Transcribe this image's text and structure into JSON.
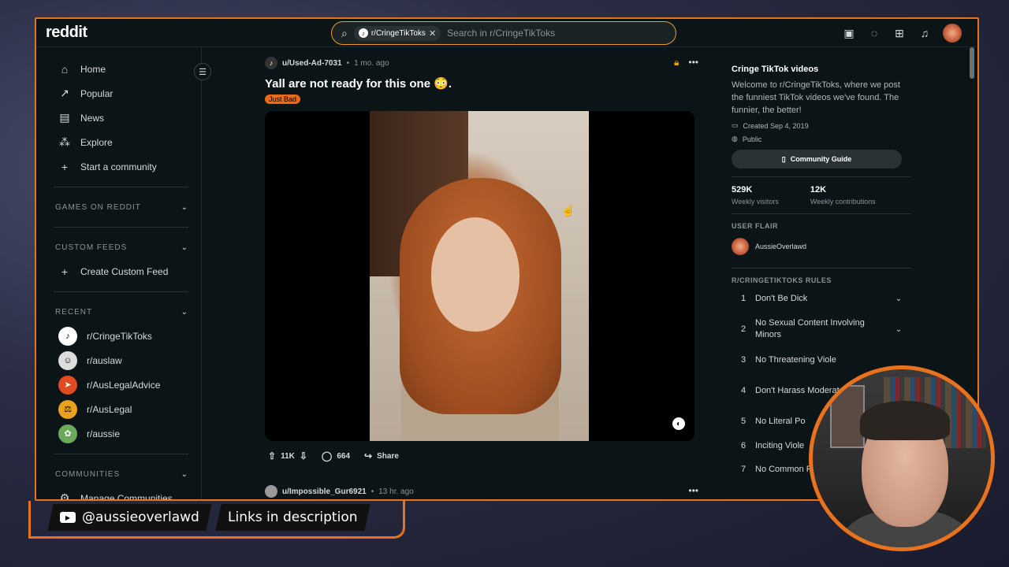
{
  "header": {
    "logo": "reddit",
    "search_chip": "r/CringeTikToks",
    "search_placeholder": "Search in r/CringeTikToks"
  },
  "sidebar": {
    "nav": [
      {
        "label": "Home",
        "icon": "home-icon"
      },
      {
        "label": "Popular",
        "icon": "popular-icon"
      },
      {
        "label": "News",
        "icon": "news-icon"
      },
      {
        "label": "Explore",
        "icon": "explore-icon"
      },
      {
        "label": "Start a community",
        "icon": "plus-icon"
      }
    ],
    "games_header": "GAMES ON REDDIT",
    "custom_feeds_header": "CUSTOM FEEDS",
    "create_custom_feed": "Create Custom Feed",
    "recent_header": "RECENT",
    "recent": [
      {
        "label": "r/CringeTikToks",
        "color": "#ffffff"
      },
      {
        "label": "r/auslaw",
        "color": "#dddddd"
      },
      {
        "label": "r/AusLegalAdvice",
        "color": "#e04a1e"
      },
      {
        "label": "r/AusLegal",
        "color": "#e8a21e"
      },
      {
        "label": "r/aussie",
        "color": "#6aaa5a"
      }
    ],
    "communities_header": "COMMUNITIES",
    "manage_communities": "Manage Communities"
  },
  "post": {
    "username": "u/Used-Ad-7031",
    "age": "1 mo. ago",
    "title": "Yall are not ready for this one 😳.",
    "flair": "Just Bad",
    "votes": "11K",
    "comments": "664",
    "share": "Share"
  },
  "post2": {
    "username": "u/Impossible_Gur6921",
    "age": "13 hr. ago"
  },
  "community": {
    "name": "Cringe TikTok videos",
    "description": "Welcome to r/CringeTikToks, where we post the funniest TikTok videos we've found. The funnier, the better!",
    "created": "Created Sep 4, 2019",
    "visibility": "Public",
    "guide_button": "Community Guide",
    "visitors": "529K",
    "visitors_label": "Weekly visitors",
    "contributions": "12K",
    "contributions_label": "Weekly contributions",
    "user_flair_header": "USER FLAIR",
    "user_flair_name": "AussieOverlawd",
    "rules_header": "R/CRINGETIKTOKS RULES",
    "rules": [
      {
        "n": "1",
        "text": "Don't Be Dick"
      },
      {
        "n": "2",
        "text": "No Sexual Content Involving Minors"
      },
      {
        "n": "3",
        "text": "No Threatening Viole"
      },
      {
        "n": "4",
        "text": "Don't Harass Moderators/U"
      },
      {
        "n": "5",
        "text": "No Literal Po"
      },
      {
        "n": "6",
        "text": "Inciting Viole"
      },
      {
        "n": "7",
        "text": "No Common R"
      }
    ]
  },
  "overlay": {
    "youtube_handle": "@aussieoverlawd",
    "links_text": "Links in description"
  },
  "colors": {
    "accent": "#e8721e",
    "flair": "#ea6a16",
    "background": "#0b1416"
  }
}
